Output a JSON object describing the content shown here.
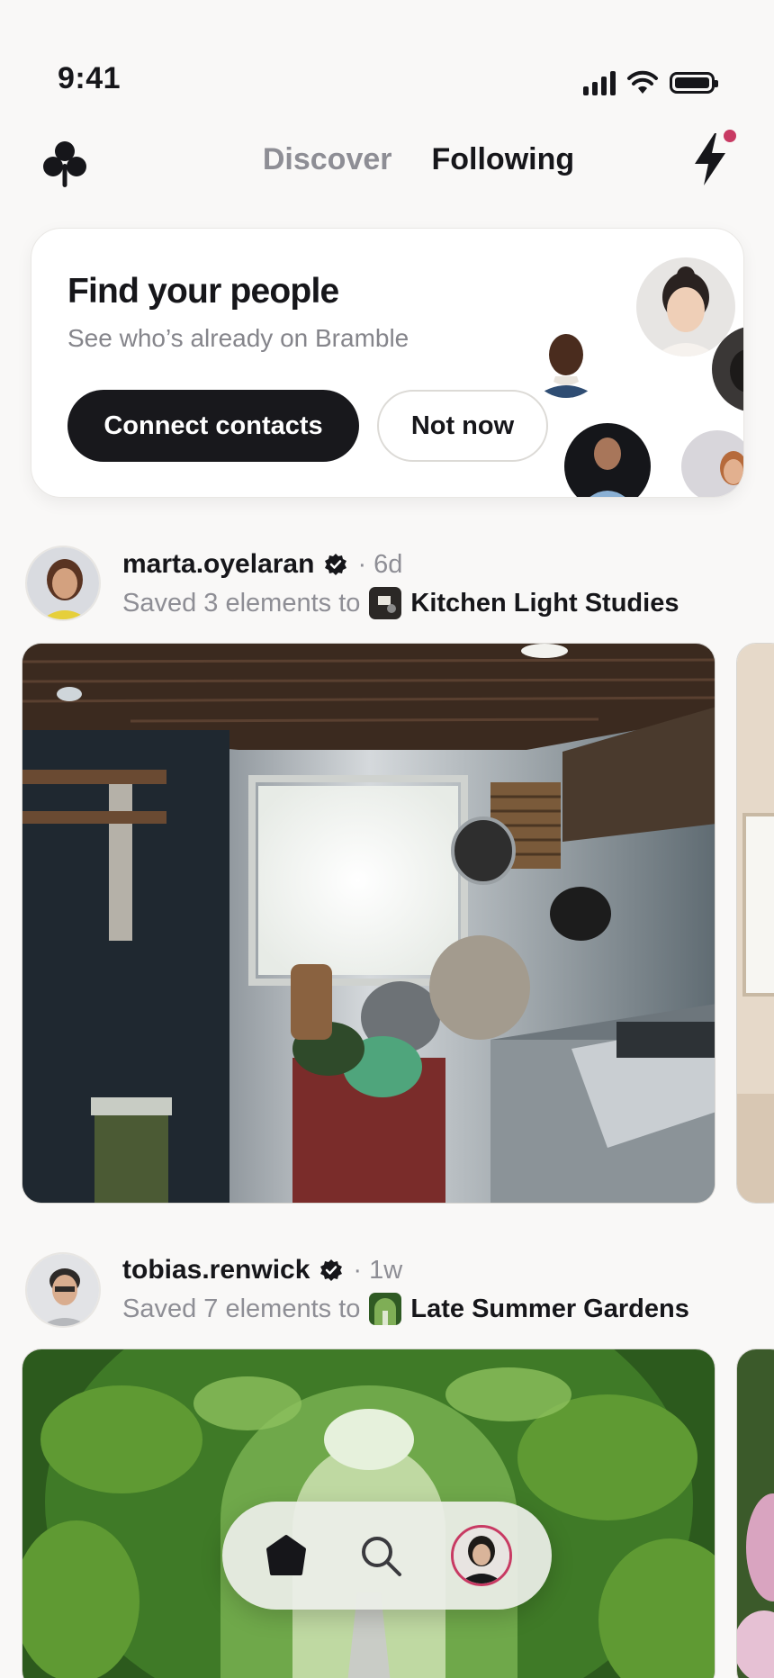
{
  "status_bar": {
    "time": "9:41",
    "icons": [
      "signal-icon",
      "wifi-icon",
      "battery-icon"
    ]
  },
  "header": {
    "logo_icon": "clover-logo",
    "tabs": [
      {
        "label": "Discover",
        "active": false
      },
      {
        "label": "Following",
        "active": true
      }
    ],
    "activity_icon": "bolt-icon",
    "has_notification": true,
    "accent": "#c83a63"
  },
  "find_people": {
    "title": "Find your people",
    "subtitle": "See who’s already on Bramble",
    "primary_button": "Connect contacts",
    "secondary_button": "Not now"
  },
  "feed": [
    {
      "username": "marta.oyelaran",
      "verified": true,
      "age": "· 6d",
      "action": "Saved 3 elements to",
      "board": "Kitchen Light Studies"
    },
    {
      "username": "tobias.renwick",
      "verified": true,
      "age": "· 1w",
      "action": "Saved 7 elements to",
      "board": "Late Summer Gardens"
    }
  ],
  "bottom_nav": {
    "items": [
      {
        "icon": "home-icon",
        "active": true
      },
      {
        "icon": "search-icon",
        "active": false
      },
      {
        "icon": "profile-avatar",
        "active": false
      }
    ]
  },
  "colors": {
    "background": "#f9f8f7",
    "primary": "#18181c",
    "muted": "#8e8e95",
    "accent": "#c83a63"
  }
}
